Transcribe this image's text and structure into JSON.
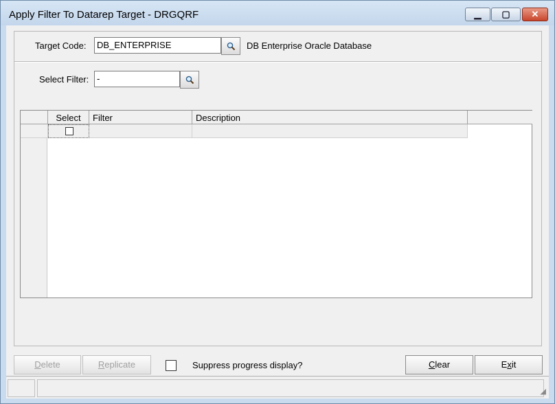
{
  "window": {
    "title": "Apply Filter To Datarep Target - DRGQRF",
    "controls": {
      "minimize": "▁",
      "maximize": "▢",
      "close": "✕"
    }
  },
  "target": {
    "label": "Target Code:",
    "value": "DB_ENTERPRISE",
    "description": "DB Enterprise Oracle Database",
    "lookup_icon": "search-icon"
  },
  "filter": {
    "label": "Select Filter:",
    "value": "-",
    "lookup_icon": "search-icon"
  },
  "grid": {
    "columns": [
      "Select",
      "Filter",
      "Description"
    ],
    "rows": [
      {
        "select": false,
        "filter": "",
        "description": ""
      }
    ]
  },
  "buttons": {
    "delete_pre": "",
    "delete_ul": "D",
    "delete_post": "elete",
    "replicate_pre": "",
    "replicate_ul": "R",
    "replicate_post": "eplicate",
    "clear_pre": "",
    "clear_ul": "C",
    "clear_post": "lear",
    "exit_pre": "E",
    "exit_ul": "x",
    "exit_post": "it"
  },
  "suppress": {
    "label": "Suppress progress display?",
    "checked": false
  },
  "colors": {
    "titlebar": "#c9dbee",
    "close_button": "#c8452c",
    "client_background": "#f0f0f0"
  }
}
